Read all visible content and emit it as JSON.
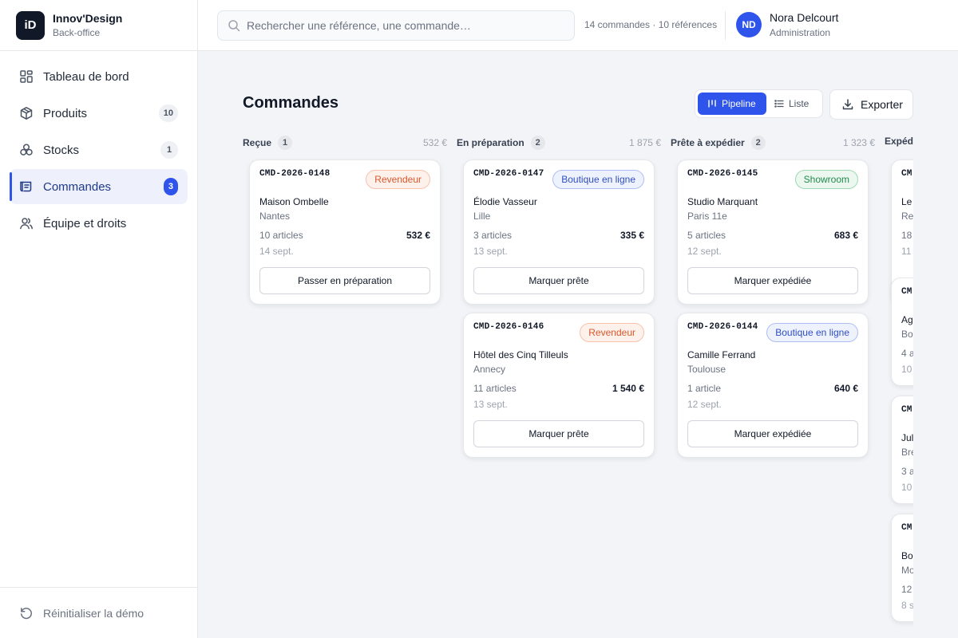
{
  "brand": {
    "logo": "iD",
    "name": "Innov'Design",
    "subtitle": "Back-office"
  },
  "sidebar": {
    "items": [
      {
        "label": "Tableau de bord",
        "icon": "dashboard-icon",
        "count": null,
        "active": false
      },
      {
        "label": "Produits",
        "icon": "box-icon",
        "count": "10",
        "active": false
      },
      {
        "label": "Stocks",
        "icon": "stacks-icon",
        "count": "1",
        "active": false
      },
      {
        "label": "Commandes",
        "icon": "orders-icon",
        "count": "3",
        "active": true
      },
      {
        "label": "Équipe et droits",
        "icon": "team-icon",
        "count": null,
        "active": false
      }
    ],
    "reset_label": "Réinitialiser la démo"
  },
  "topbar": {
    "search_placeholder": "Rechercher une référence, une commande…",
    "stats": "14 commandes · 10 références",
    "user": {
      "initials": "ND",
      "name": "Nora Delcourt",
      "role": "Administration"
    }
  },
  "page": {
    "title": "Commandes",
    "view_pipeline": "Pipeline",
    "view_list": "Liste",
    "export_label": "Exporter"
  },
  "colors": {
    "accent": "#2f54eb",
    "revendeur": "#d9582b",
    "boutique": "#2f4ec0",
    "showroom": "#1f8a4c"
  },
  "columns": [
    {
      "title": "Reçue",
      "count": "1",
      "total": "532 €",
      "cards": [
        {
          "ref": "CMD-2026-0148",
          "channel": "Revendeur",
          "client": "Maison Ombelle",
          "city": "Nantes",
          "articles": "10 articles",
          "amount": "532 €",
          "date": "14 sept.",
          "action": "Passer en préparation"
        }
      ]
    },
    {
      "title": "En préparation",
      "count": "2",
      "total": "1 875 €",
      "cards": [
        {
          "ref": "CMD-2026-0147",
          "channel": "Boutique en ligne",
          "client": "Élodie Vasseur",
          "city": "Lille",
          "articles": "3 articles",
          "amount": "335 €",
          "date": "13 sept.",
          "action": "Marquer prête"
        },
        {
          "ref": "CMD-2026-0146",
          "channel": "Revendeur",
          "client": "Hôtel des Cinq Tilleuls",
          "city": "Annecy",
          "articles": "11 articles",
          "amount": "1 540 €",
          "date": "13 sept.",
          "action": "Marquer prête"
        }
      ]
    },
    {
      "title": "Prête à expédier",
      "count": "2",
      "total": "1 323 €",
      "cards": [
        {
          "ref": "CMD-2026-0145",
          "channel": "Showroom",
          "client": "Studio Marquant",
          "city": "Paris 11e",
          "articles": "5 articles",
          "amount": "683 €",
          "date": "12 sept.",
          "action": "Marquer expédiée"
        },
        {
          "ref": "CMD-2026-0144",
          "channel": "Boutique en ligne",
          "client": "Camille Ferrand",
          "city": "Toulouse",
          "articles": "1 article",
          "amount": "640 €",
          "date": "12 sept.",
          "action": "Marquer expédiée"
        }
      ]
    },
    {
      "title": "Expéd",
      "count": "",
      "total": "",
      "cards": [
        {
          "ref": "CM",
          "channel": "",
          "client": "Le",
          "city": "Re",
          "articles": "18",
          "amount": "",
          "date": "11",
          "action": ""
        },
        {
          "ref": "CM",
          "channel": "",
          "client": "Ag",
          "city": "Bo",
          "articles": "4 a",
          "amount": "",
          "date": "10",
          "action": ""
        },
        {
          "ref": "CM",
          "channel": "",
          "client": "Jul",
          "city": "Bre",
          "articles": "3 a",
          "amount": "",
          "date": "10",
          "action": ""
        },
        {
          "ref": "CM",
          "channel": "",
          "client": "Bo",
          "city": "Mo",
          "articles": "12",
          "amount": "",
          "date": "8 s",
          "action": ""
        }
      ]
    }
  ]
}
